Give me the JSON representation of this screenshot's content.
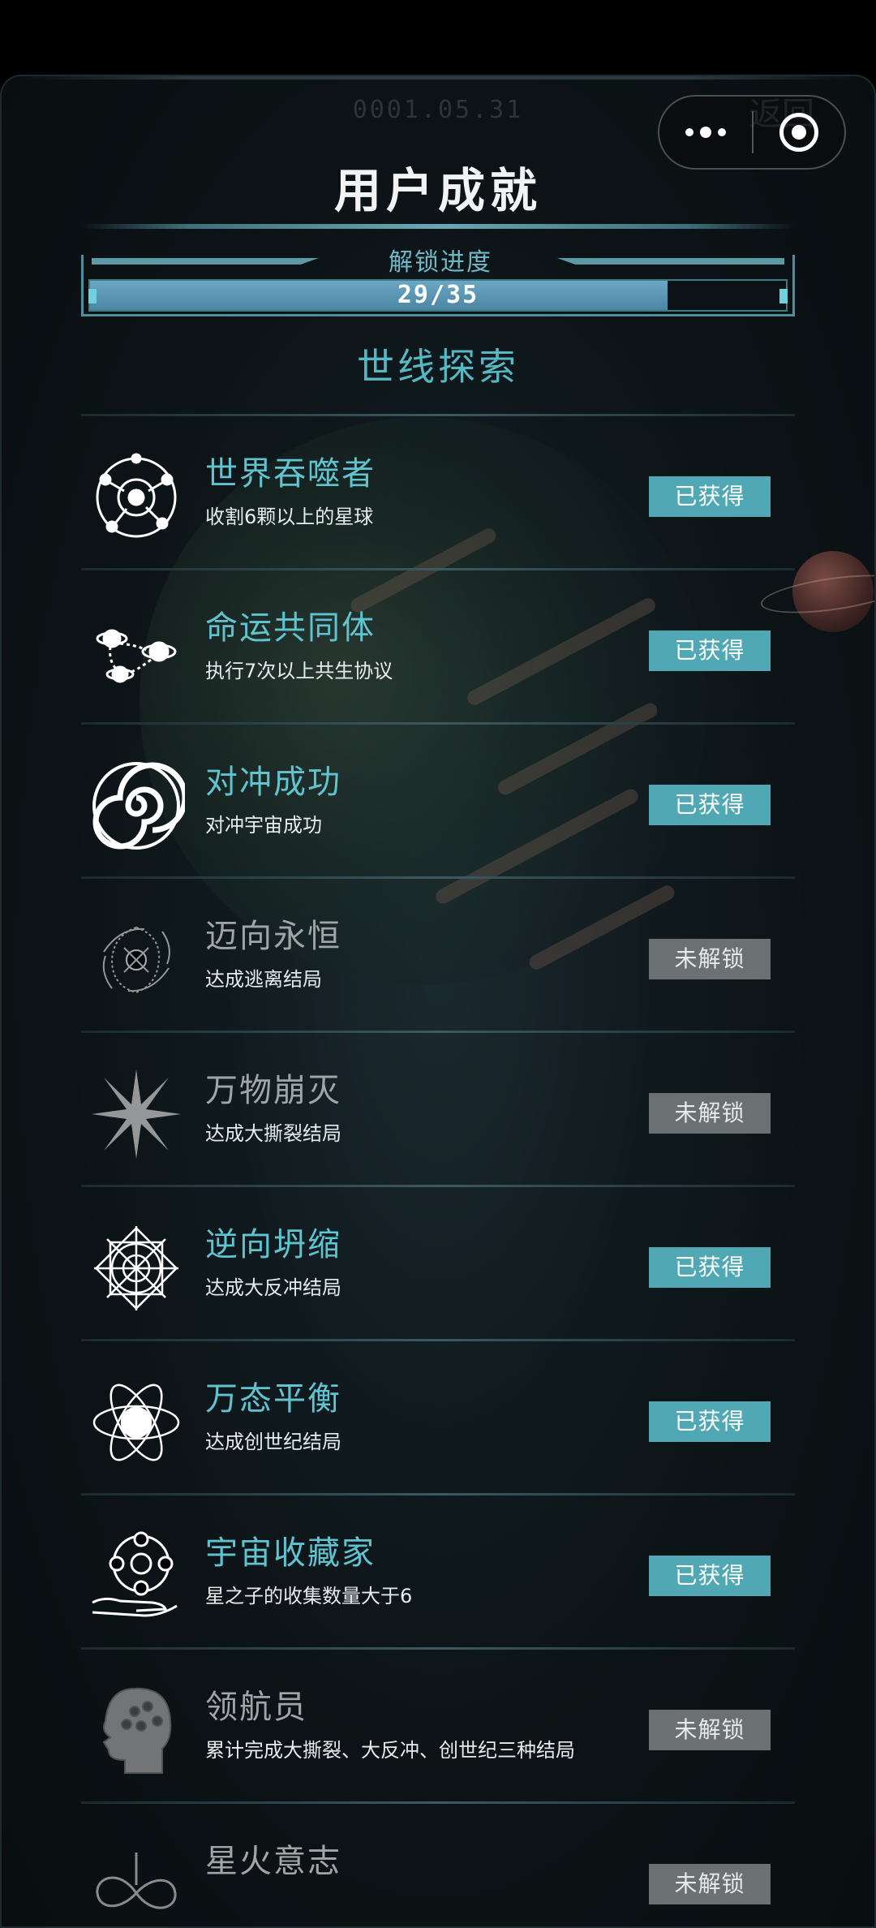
{
  "header": {
    "timestamp": "0001.05.31",
    "back_label": "返回",
    "title": "用户成就"
  },
  "progress": {
    "label": "解锁进度",
    "text": "29/35",
    "unlocked": 29,
    "total": 35,
    "fill_fraction": 0.83
  },
  "section": {
    "title": "世线探索"
  },
  "achievements": [
    {
      "name": "世界吞噬者",
      "desc": "收割6颗以上的星球",
      "status": "已获得",
      "earned": true,
      "icon": "planet-orbit-icon"
    },
    {
      "name": "命运共同体",
      "desc": "执行7次以上共生协议",
      "status": "已获得",
      "earned": true,
      "icon": "linked-planets-icon"
    },
    {
      "name": "对冲成功",
      "desc": "对冲宇宙成功",
      "status": "已获得",
      "earned": true,
      "icon": "spiral-vortex-icon"
    },
    {
      "name": "迈向永恒",
      "desc": "达成逃离结局",
      "status": "未解锁",
      "earned": false,
      "icon": "black-hole-icon"
    },
    {
      "name": "万物崩灭",
      "desc": "达成大撕裂结局",
      "status": "未解锁",
      "earned": false,
      "icon": "burst-icon"
    },
    {
      "name": "逆向坍缩",
      "desc": "达成大反冲结局",
      "status": "已获得",
      "earned": true,
      "icon": "mandala-icon"
    },
    {
      "name": "万态平衡",
      "desc": "达成创世纪结局",
      "status": "已获得",
      "earned": true,
      "icon": "atom-orbit-icon"
    },
    {
      "name": "宇宙收藏家",
      "desc": "星之子的收集数量大于6",
      "status": "已获得",
      "earned": true,
      "icon": "sphere-hand-icon"
    },
    {
      "name": "领航员",
      "desc": "累计完成大撕裂、大反冲、创世纪三种结局",
      "status": "未解锁",
      "earned": false,
      "icon": "brain-head-icon"
    },
    {
      "name": "星火意志",
      "desc": "",
      "status": "未解锁",
      "earned": false,
      "icon": "infinity-icon"
    }
  ],
  "colors": {
    "accent": "#5fc4d0",
    "earned_badge": "#4fa8b4",
    "locked_badge": "#6b7072"
  }
}
